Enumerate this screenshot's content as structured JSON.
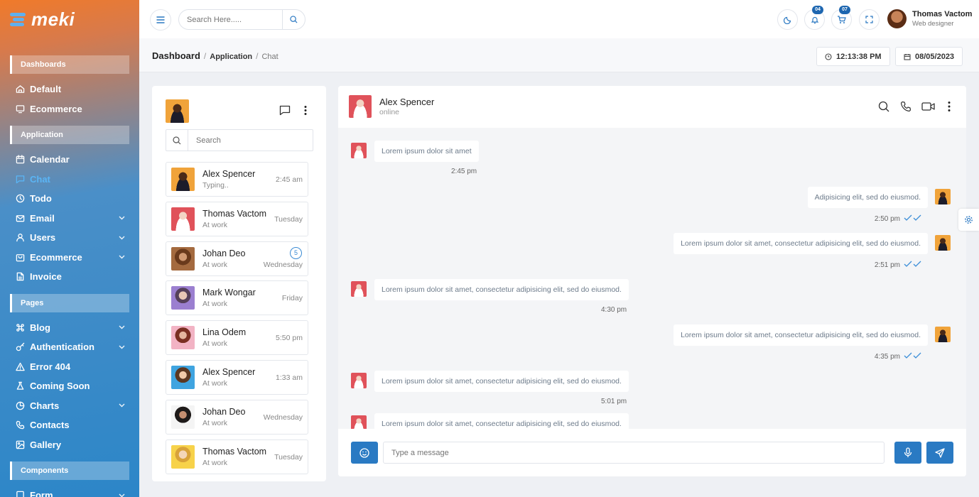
{
  "app": {
    "logo_text": "meki",
    "brand_color": "#2a7ac3"
  },
  "sidebar": {
    "sections": [
      {
        "title": "Dashboards",
        "items": [
          {
            "label": "Default",
            "icon": "home-icon",
            "chevron": false,
            "active": false
          },
          {
            "label": "Ecommerce",
            "icon": "monitor-icon",
            "chevron": false,
            "active": false
          }
        ]
      },
      {
        "title": "Application",
        "items": [
          {
            "label": "Calendar",
            "icon": "calendar-icon",
            "chevron": false,
            "active": false
          },
          {
            "label": "Chat",
            "icon": "chat-icon",
            "chevron": false,
            "active": true
          },
          {
            "label": "Todo",
            "icon": "clock-icon",
            "chevron": false,
            "active": false
          },
          {
            "label": "Email",
            "icon": "mail-icon",
            "chevron": true,
            "active": false
          },
          {
            "label": "Users",
            "icon": "user-icon",
            "chevron": true,
            "active": false
          },
          {
            "label": "Ecommerce",
            "icon": "bag-icon",
            "chevron": true,
            "active": false
          },
          {
            "label": "Invoice",
            "icon": "file-icon",
            "chevron": false,
            "active": false
          }
        ]
      },
      {
        "title": "Pages",
        "items": [
          {
            "label": "Blog",
            "icon": "command-icon",
            "chevron": true,
            "active": false
          },
          {
            "label": "Authentication",
            "icon": "key-icon",
            "chevron": true,
            "active": false
          },
          {
            "label": "Error 404",
            "icon": "warning-icon",
            "chevron": false,
            "active": false
          },
          {
            "label": "Coming Soon",
            "icon": "flask-icon",
            "chevron": false,
            "active": false
          },
          {
            "label": "Charts",
            "icon": "pie-icon",
            "chevron": true,
            "active": false
          },
          {
            "label": "Contacts",
            "icon": "phone-icon",
            "chevron": false,
            "active": false
          },
          {
            "label": "Gallery",
            "icon": "image-icon",
            "chevron": false,
            "active": false
          }
        ]
      },
      {
        "title": "Components",
        "items": [
          {
            "label": "Form",
            "icon": "form-icon",
            "chevron": true,
            "active": false
          }
        ]
      }
    ]
  },
  "topbar": {
    "search_placeholder": "Search Here.....",
    "notifications_count": "04",
    "cart_count": "07",
    "user_name": "Thomas Vactom",
    "user_role": "Web designer"
  },
  "breadcrumb": {
    "root": "Dashboard",
    "section": "Application",
    "current": "Chat",
    "sep": "/"
  },
  "clock": {
    "time": "12:13:38 PM",
    "date": "08/05/2023"
  },
  "contacts": {
    "search_placeholder": "Search",
    "items": [
      {
        "name": "Alex Spencer",
        "status": "Typing..",
        "time": "2:45 am",
        "unread": "",
        "avatar": "av-orange"
      },
      {
        "name": "Thomas Vactom",
        "status": "At work",
        "time": "Tuesday",
        "unread": "",
        "avatar": "av-red"
      },
      {
        "name": "Johan Deo",
        "status": "At work",
        "time": "Wednesday",
        "unread": "5",
        "avatar": "av-brown"
      },
      {
        "name": "Mark Wongar",
        "status": "At work",
        "time": "Friday",
        "unread": "",
        "avatar": "av-purple"
      },
      {
        "name": "Lina Odem",
        "status": "At work",
        "time": "5:50 pm",
        "unread": "",
        "avatar": "av-pink"
      },
      {
        "name": "Alex Spencer",
        "status": "At work",
        "time": "1:33 am",
        "unread": "",
        "avatar": "av-blue"
      },
      {
        "name": "Johan Deo",
        "status": "At work",
        "time": "Wednesday",
        "unread": "",
        "avatar": "av-white"
      },
      {
        "name": "Thomas Vactom",
        "status": "At work",
        "time": "Tuesday",
        "unread": "",
        "avatar": "av-yellow"
      }
    ]
  },
  "chat": {
    "contact_name": "Alex Spencer",
    "contact_status": "online",
    "messages": [
      {
        "side": "in",
        "text": "Lorem ipsum dolor sit amet",
        "time": "2:45 pm"
      },
      {
        "side": "out",
        "text": "Adipisicing elit, sed do eiusmod.",
        "time": "2:50 pm"
      },
      {
        "side": "out",
        "text": "Lorem ipsum dolor sit amet, consectetur adipisicing elit, sed do eiusmod.",
        "time": "2:51 pm"
      },
      {
        "side": "in",
        "text": "Lorem ipsum dolor sit amet, consectetur adipisicing elit, sed do eiusmod.",
        "time": "4:30 pm"
      },
      {
        "side": "out",
        "text": "Lorem ipsum dolor sit amet, consectetur adipisicing elit, sed do eiusmod.",
        "time": "4:35 pm"
      },
      {
        "side": "in",
        "text": "Lorem ipsum dolor sit amet, consectetur adipisicing elit, sed do eiusmod.",
        "time": "5:01 pm"
      },
      {
        "side": "in",
        "text": "Lorem ipsum dolor sit amet, consectetur adipisicing elit, sed do eiusmod.",
        "time": ""
      }
    ],
    "input_placeholder": "Type a message"
  }
}
